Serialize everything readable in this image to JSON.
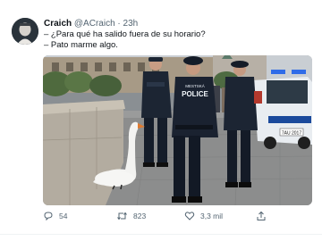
{
  "tweet": {
    "author_name": "Craich",
    "author_handle": "@ACraich",
    "separator": "·",
    "time": "23h",
    "lines": [
      "– ¿Para qué ha salido fuera de su horario?",
      "– Pato marme algo."
    ],
    "media": {
      "vest_text_left": "MESTSKÁ",
      "vest_text_right": "POLICE",
      "car_plate": "7AU 2017"
    },
    "actions": {
      "replies": "54",
      "retweets": "823",
      "likes": "3,3 mil"
    }
  },
  "colors": {
    "text_primary": "#0f1419",
    "text_secondary": "#536471"
  },
  "icons": [
    "reply-icon",
    "retweet-icon",
    "like-icon",
    "share-icon"
  ]
}
